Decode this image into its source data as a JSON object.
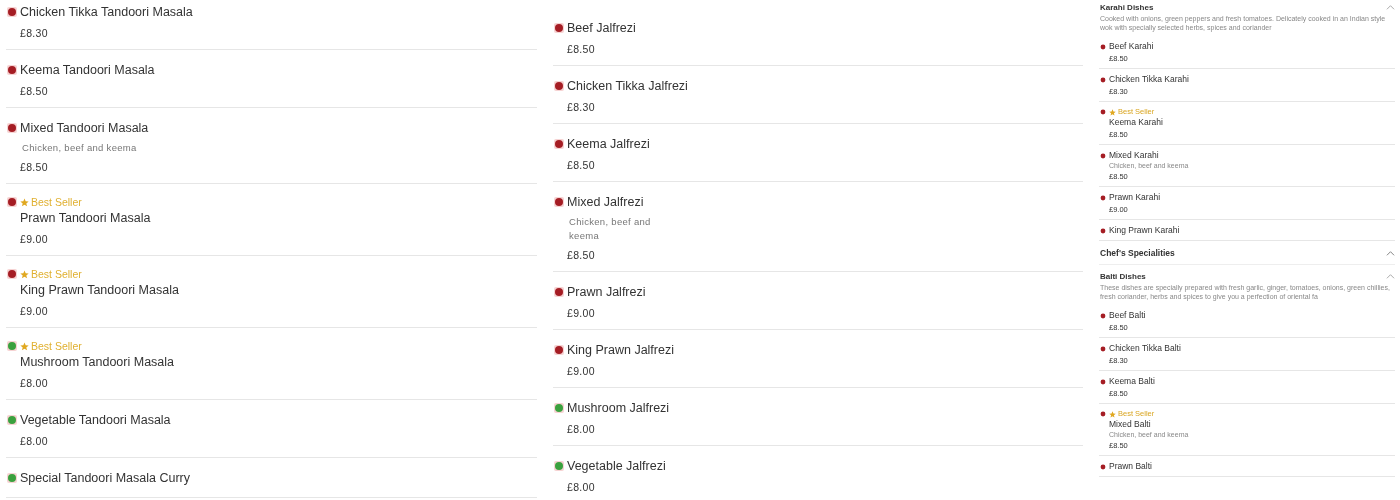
{
  "columns": [
    {
      "kind": "full",
      "blocks": [
        {
          "kind": "items",
          "items": [
            {
              "name": "Chicken Tikka Tandoori Masala",
              "price": "£8.30",
              "color": "#a51d24",
              "best_seller": false
            },
            {
              "name": "Keema Tandoori Masala",
              "price": "£8.50",
              "color": "#a51d24",
              "best_seller": false
            },
            {
              "name": "Mixed Tandoori Masala",
              "description": "Chicken, beef and keema",
              "price": "£8.50",
              "color": "#a51d24",
              "best_seller": false
            },
            {
              "name": "Prawn Tandoori Masala",
              "price": "£9.00",
              "color": "#a51d24",
              "best_seller": true,
              "badge": "Best Seller"
            },
            {
              "name": "King Prawn Tandoori Masala",
              "price": "£9.00",
              "color": "#a51d24",
              "best_seller": true,
              "badge": "Best Seller"
            },
            {
              "name": "Mushroom Tandoori Masala",
              "price": "£8.00",
              "color": "#3aa13e",
              "best_seller": true,
              "badge": "Best Seller"
            },
            {
              "name": "Vegetable Tandoori Masala",
              "price": "£8.00",
              "color": "#3aa13e",
              "best_seller": false
            },
            {
              "name": "Special Tandoori Masala Curry",
              "color": "#3aa13e",
              "best_seller": false
            }
          ]
        }
      ]
    },
    {
      "kind": "full",
      "blocks": [
        {
          "kind": "items",
          "items": [
            {
              "name": "Beef Jalfrezi",
              "price": "£8.50",
              "color": "#a51d24",
              "best_seller": false
            },
            {
              "name": "Chicken Tikka Jalfrezi",
              "price": "£8.30",
              "color": "#a51d24",
              "best_seller": false
            },
            {
              "name": "Keema Jalfrezi",
              "price": "£8.50",
              "color": "#a51d24",
              "best_seller": false
            },
            {
              "name": "Mixed Jalfrezi",
              "description": "Chicken, beef and keema",
              "price": "£8.50",
              "color": "#a51d24",
              "best_seller": false
            },
            {
              "name": "Prawn Jalfrezi",
              "price": "£9.00",
              "color": "#a51d24",
              "best_seller": false
            },
            {
              "name": "King Prawn Jalfrezi",
              "price": "£9.00",
              "color": "#a51d24",
              "best_seller": false
            },
            {
              "name": "Mushroom Jalfrezi",
              "price": "£8.00",
              "color": "#3aa13e",
              "best_seller": false
            },
            {
              "name": "Vegetable Jalfrezi",
              "price": "£8.00",
              "color": "#3aa13e",
              "best_seller": false
            }
          ]
        }
      ]
    },
    {
      "kind": "compact",
      "blocks": [
        {
          "kind": "section",
          "title": "Karahi Dishes",
          "expanded": true,
          "description": "Cooked with onions, green peppers and fresh tomatoes. Delicately cooked in an Indian style wok with specially selected herbs, spices and coriander",
          "items": [
            {
              "name": "Beef Karahi",
              "price": "£8.50",
              "color": "#a51d24",
              "best_seller": false
            },
            {
              "name": "Chicken Tikka Karahi",
              "price": "£8.30",
              "color": "#a51d24",
              "best_seller": false
            },
            {
              "name": "Keema Karahi",
              "price": "£8.50",
              "color": "#a51d24",
              "best_seller": true,
              "badge": "Best Seller"
            },
            {
              "name": "Mixed Karahi",
              "description": "Chicken, beef and keema",
              "price": "£8.50",
              "color": "#a51d24",
              "best_seller": false
            },
            {
              "name": "Prawn Karahi",
              "price": "£9.00",
              "color": "#a51d24",
              "best_seller": false
            },
            {
              "name": "King Prawn Karahi",
              "color": "#a51d24",
              "best_seller": false
            }
          ]
        },
        {
          "kind": "category",
          "title": "Chef's Specialities",
          "expanded": true
        },
        {
          "kind": "section",
          "title": "Balti Dishes",
          "expanded": true,
          "description": "These dishes are specially prepared with fresh garlic, ginger, tomatoes, onions, green chillies, fresh coriander, herbs and spices to give you a perfection of oriental fa",
          "items": [
            {
              "name": "Beef Balti",
              "price": "£8.50",
              "color": "#a51d24",
              "best_seller": false
            },
            {
              "name": "Chicken Tikka Balti",
              "price": "£8.30",
              "color": "#a51d24",
              "best_seller": false
            },
            {
              "name": "Keema Balti",
              "price": "£8.50",
              "color": "#a51d24",
              "best_seller": false
            },
            {
              "name": "Mixed Balti",
              "description": "Chicken, beef and keema",
              "price": "£8.50",
              "color": "#a51d24",
              "best_seller": true,
              "badge": "Best Seller"
            },
            {
              "name": "Prawn Balti",
              "color": "#a51d24",
              "best_seller": false
            }
          ]
        }
      ]
    }
  ]
}
